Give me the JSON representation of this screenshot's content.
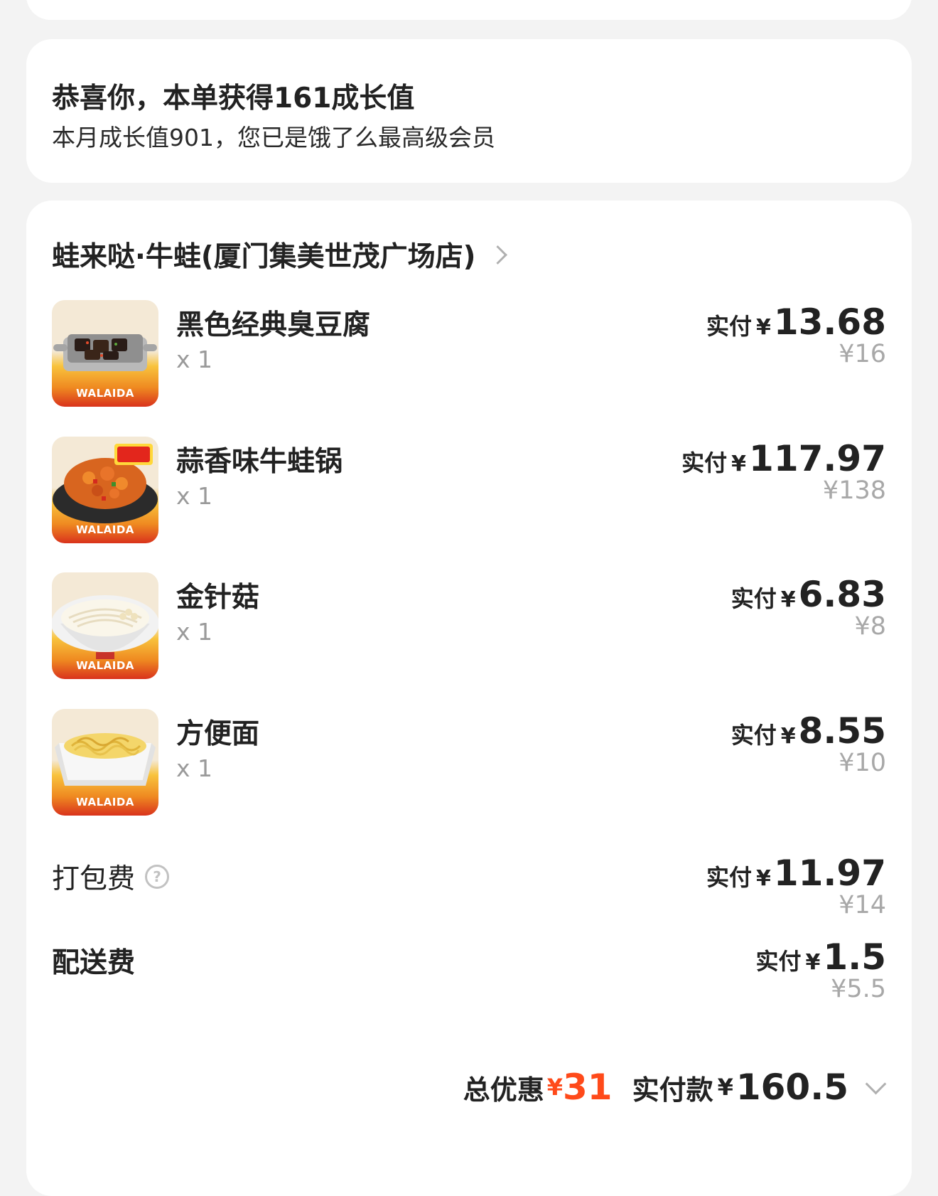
{
  "growth": {
    "title": "恭喜你，本单获得161成长值",
    "subtitle": "本月成长值901，您已是饿了么最高级会员"
  },
  "store": {
    "name": "蛙来哒·牛蛙(厦门集美世茂广场店)"
  },
  "labels": {
    "paid": "实付",
    "yen": "¥",
    "total_discount": "总优惠",
    "total_paid": "实付款"
  },
  "items": [
    {
      "name": "黑色经典臭豆腐",
      "qty": "x 1",
      "paid": "13.68",
      "original": "¥16",
      "brand": "WALAIDA",
      "icon": "stinky-tofu-dish"
    },
    {
      "name": "蒜香味牛蛙锅",
      "qty": "x 1",
      "paid": "117.97",
      "original": "¥138",
      "brand": "WALAIDA",
      "icon": "frog-pot-dish"
    },
    {
      "name": "金针菇",
      "qty": "x 1",
      "paid": "6.83",
      "original": "¥8",
      "brand": "WALAIDA",
      "icon": "enoki-mushroom-bowl"
    },
    {
      "name": "方便面",
      "qty": "x 1",
      "paid": "8.55",
      "original": "¥10",
      "brand": "WALAIDA",
      "icon": "instant-noodles-dish"
    }
  ],
  "fees": {
    "packing": {
      "name": "打包费",
      "paid": "11.97",
      "original": "¥14",
      "help_icon": "help-icon"
    },
    "delivery": {
      "name": "配送费",
      "paid": "1.5",
      "original": "¥5.5"
    }
  },
  "summary": {
    "discount": "31",
    "total": "160.5"
  },
  "colors": {
    "accent_red": "#ff4a1a",
    "background": "#f3f3f3",
    "card": "#ffffff",
    "muted": "#a8a8a8"
  }
}
